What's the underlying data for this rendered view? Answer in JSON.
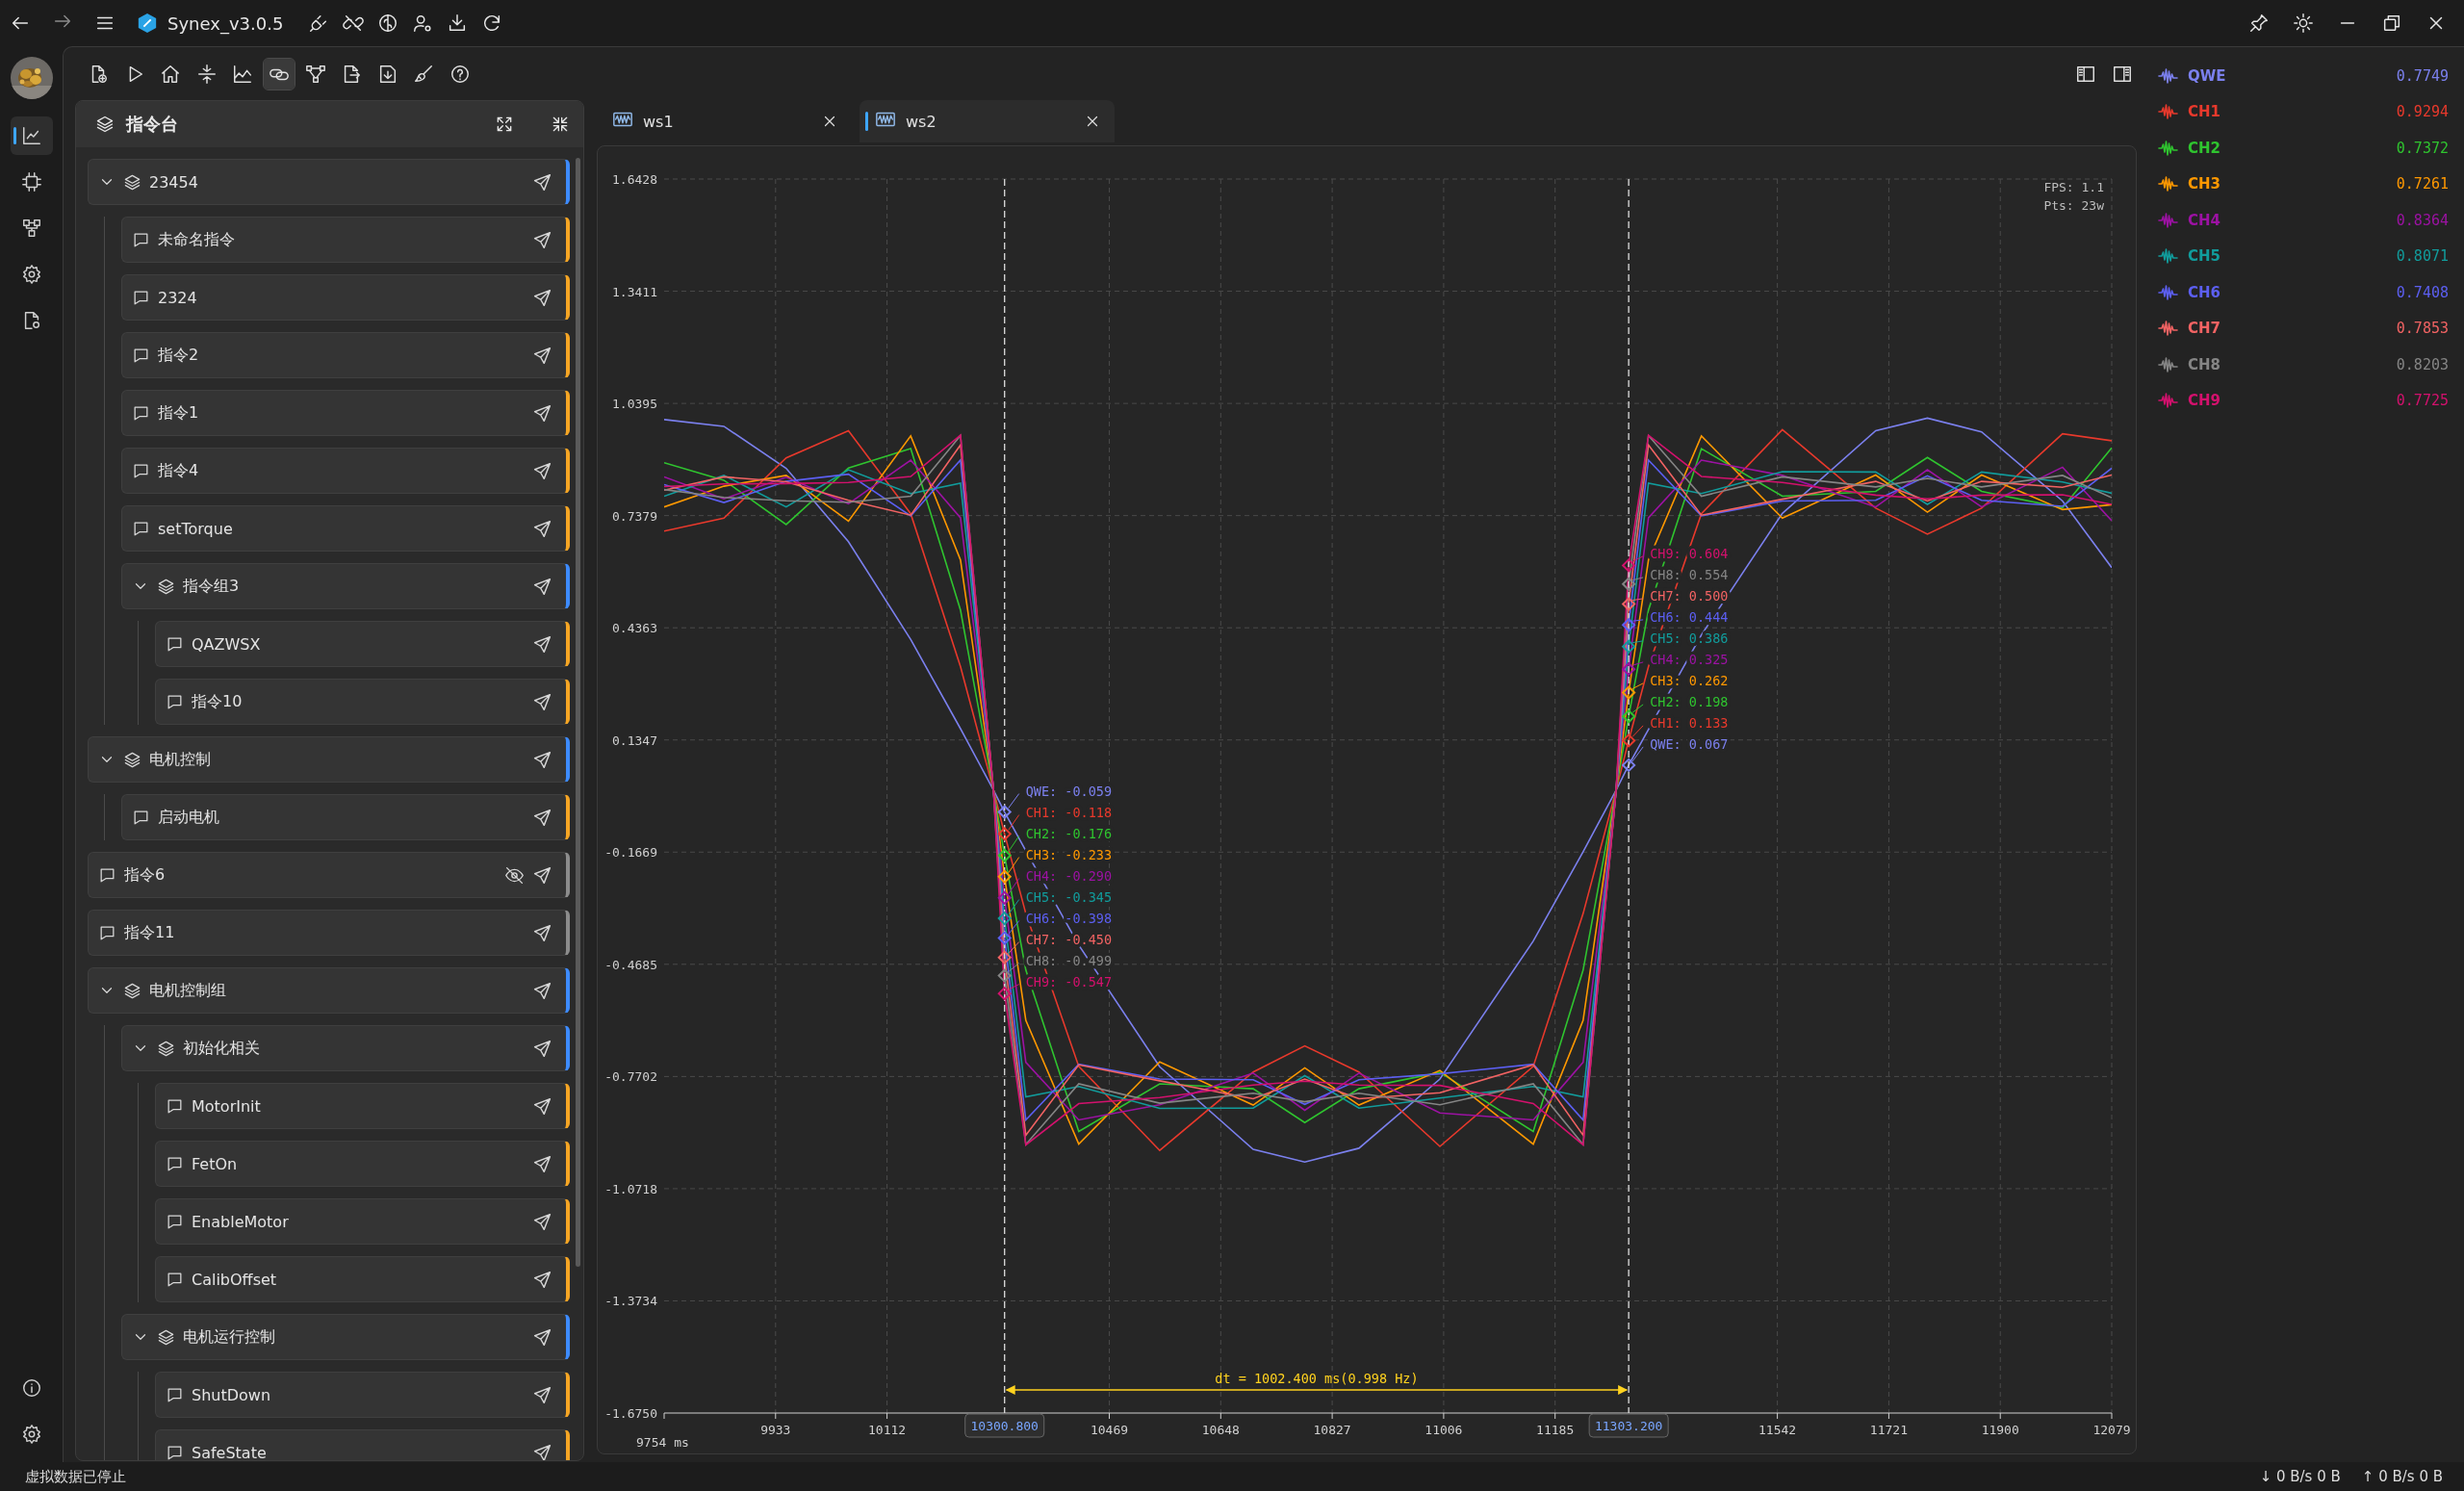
{
  "titlebar": {
    "title": "Synex_v3.0.5"
  },
  "sidebar": {
    "items": [
      {
        "kind": "chart",
        "selected": true
      },
      {
        "kind": "chip",
        "selected": false
      },
      {
        "kind": "network",
        "selected": false
      },
      {
        "kind": "gear",
        "selected": false
      },
      {
        "kind": "document",
        "selected": false
      }
    ]
  },
  "toolbar": [
    {
      "kind": "file-add",
      "selected": false
    },
    {
      "kind": "play",
      "selected": false
    },
    {
      "kind": "home",
      "selected": false
    },
    {
      "kind": "collapse",
      "selected": false
    },
    {
      "kind": "area-chart",
      "selected": false
    },
    {
      "kind": "link",
      "selected": true
    },
    {
      "kind": "nodes",
      "selected": false
    },
    {
      "kind": "export",
      "selected": false
    },
    {
      "kind": "import",
      "selected": false
    },
    {
      "kind": "brush",
      "selected": false
    },
    {
      "kind": "help",
      "selected": false
    }
  ],
  "command_panel": {
    "title": "指令台",
    "items": [
      {
        "kind": "group",
        "label": "23454",
        "expanded": true,
        "hidden": false,
        "children": [
          {
            "kind": "command",
            "label": "未命名指令",
            "hidden": false
          },
          {
            "kind": "command",
            "label": "2324",
            "hidden": false
          },
          {
            "kind": "command",
            "label": "指令2",
            "hidden": false
          },
          {
            "kind": "command",
            "label": "指令1",
            "hidden": false
          },
          {
            "kind": "command",
            "label": "指令4",
            "hidden": false
          },
          {
            "kind": "command",
            "label": "setTorque",
            "hidden": false
          },
          {
            "kind": "group",
            "label": "指令组3",
            "expanded": true,
            "hidden": false,
            "children": [
              {
                "kind": "command",
                "label": "QAZWSX",
                "hidden": false
              },
              {
                "kind": "command",
                "label": "指令10",
                "hidden": false
              }
            ]
          }
        ]
      },
      {
        "kind": "group",
        "label": "电机控制",
        "expanded": true,
        "hidden": false,
        "children": [
          {
            "kind": "command",
            "label": "启动电机",
            "hidden": false
          }
        ]
      },
      {
        "kind": "command",
        "label": "指令6",
        "hidden": true
      },
      {
        "kind": "command",
        "label": "指令11",
        "hidden": false
      },
      {
        "kind": "group",
        "label": "电机控制组",
        "expanded": true,
        "hidden": false,
        "children": [
          {
            "kind": "group",
            "label": "初始化相关",
            "expanded": true,
            "hidden": false,
            "children": [
              {
                "kind": "command",
                "label": "MotorInit",
                "hidden": false
              },
              {
                "kind": "command",
                "label": "FetOn",
                "hidden": false
              },
              {
                "kind": "command",
                "label": "EnableMotor",
                "hidden": false
              },
              {
                "kind": "command",
                "label": "CalibOffset",
                "hidden": false
              }
            ]
          },
          {
            "kind": "group",
            "label": "电机运行控制",
            "expanded": true,
            "hidden": false,
            "children": [
              {
                "kind": "command",
                "label": "ShutDown",
                "hidden": false
              },
              {
                "kind": "command",
                "label": "SafeState",
                "hidden": false
              }
            ]
          }
        ]
      }
    ]
  },
  "tabs": [
    {
      "label": "ws1",
      "selected": false
    },
    {
      "label": "ws2",
      "selected": true
    }
  ],
  "chart": {
    "stats": [
      "FPS: 1.1",
      "Pts: 23w"
    ],
    "cursor_readouts": [
      [
        {
          "text": "QWE: -0.059",
          "color": "#7b80ee"
        },
        {
          "text": "CH1: -0.118",
          "color": "#e8392c"
        },
        {
          "text": "CH2: -0.176",
          "color": "#2fc42f"
        },
        {
          "text": "CH3: -0.233",
          "color": "#ff9800"
        },
        {
          "text": "CH4: -0.290",
          "color": "#9c12a3"
        },
        {
          "text": "CH5: -0.345",
          "color": "#119c9c"
        },
        {
          "text": "CH6: -0.398",
          "color": "#5c5ff2"
        },
        {
          "text": "CH7: -0.450",
          "color": "#f26363"
        },
        {
          "text": "CH8: -0.499",
          "color": "#858585"
        },
        {
          "text": "CH9: -0.547",
          "color": "#d3116d"
        }
      ],
      [
        {
          "text": "CH9: 0.604",
          "color": "#d3116d"
        },
        {
          "text": "CH8: 0.554",
          "color": "#858585"
        },
        {
          "text": "CH7: 0.500",
          "color": "#f26363"
        },
        {
          "text": "CH6: 0.444",
          "color": "#5c5ff2"
        },
        {
          "text": "CH5: 0.386",
          "color": "#119c9c"
        },
        {
          "text": "CH4: 0.325",
          "color": "#9c12a3"
        },
        {
          "text": "CH3: 0.262",
          "color": "#ff9800"
        },
        {
          "text": "CH2: 0.198",
          "color": "#2fc42f"
        },
        {
          "text": "CH1: 0.133",
          "color": "#e8392c"
        },
        {
          "text": "QWE: 0.067",
          "color": "#7b80ee"
        }
      ]
    ],
    "chart_data": {
      "type": "line",
      "x": [
        9754,
        9850,
        9950,
        10050,
        10150,
        10230,
        10283,
        10300.8,
        10335,
        10420,
        10550,
        10700,
        10783,
        10870,
        11000,
        11150,
        11230,
        11283,
        11303.2,
        11335,
        11420,
        11550,
        11700,
        11783,
        11870,
        12000,
        12079
      ],
      "series": [
        {
          "name": "QWE",
          "color": "#7b80ee",
          "values": [
            0.996,
            0.978,
            0.865,
            0.668,
            0.405,
            0.165,
            0,
            -0.059,
            -0.163,
            -0.417,
            -0.744,
            -0.966,
            -1.0,
            -0.963,
            -0.777,
            -0.406,
            -0.166,
            0,
            0.067,
            0.163,
            0.417,
            0.744,
            0.966,
            1.0,
            0.963,
            0.777,
            0.598
          ]
        },
        {
          "name": "CH1",
          "color": "#e8392c",
          "values": [
            0.696,
            0.731,
            0.893,
            0.966,
            0.743,
            0.332,
            0,
            -0.118,
            -0.332,
            -0.743,
            -0.969,
            -0.758,
            -0.688,
            -0.758,
            -0.958,
            -0.743,
            -0.332,
            0,
            0.133,
            0.332,
            0.743,
            0.969,
            0.758,
            0.688,
            0.758,
            0.958,
            0.939
          ]
        },
        {
          "name": "CH2",
          "color": "#2fc42f",
          "values": [
            0.88,
            0.833,
            0.714,
            0.866,
            0.918,
            0.484,
            0,
            -0.176,
            -0.484,
            -0.918,
            -0.79,
            -0.803,
            -0.894,
            -0.803,
            -0.759,
            -0.918,
            -0.484,
            0,
            0.198,
            0.484,
            0.918,
            0.79,
            0.803,
            0.894,
            0.803,
            0.759,
            0.92
          ]
        },
        {
          "name": "CH3",
          "color": "#ff9800",
          "values": [
            0.761,
            0.817,
            0.846,
            0.723,
            0.952,
            0.619,
            0,
            -0.233,
            -0.619,
            -0.952,
            -0.731,
            -0.847,
            -0.747,
            -0.847,
            -0.754,
            -0.952,
            -0.619,
            0,
            0.262,
            0.619,
            0.952,
            0.731,
            0.847,
            0.747,
            0.847,
            0.754,
            0.767
          ]
        },
        {
          "name": "CH4",
          "color": "#9c12a3",
          "values": [
            0.842,
            0.783,
            0.841,
            0.77,
            0.887,
            0.732,
            0,
            -0.29,
            -0.732,
            -0.887,
            -0.846,
            -0.761,
            -0.861,
            -0.761,
            -0.868,
            -0.887,
            -0.732,
            0,
            0.325,
            0.732,
            0.887,
            0.846,
            0.761,
            0.861,
            0.761,
            0.868,
            0.724
          ]
        },
        {
          "name": "CH5",
          "color": "#119c9c",
          "values": [
            0.79,
            0.846,
            0.761,
            0.861,
            0.797,
            0.825,
            0,
            -0.345,
            -0.825,
            -0.797,
            -0.856,
            -0.855,
            -0.768,
            -0.855,
            -0.828,
            -0.797,
            -0.825,
            0,
            0.386,
            0.825,
            0.797,
            0.856,
            0.855,
            0.768,
            0.855,
            0.828,
            0.798
          ]
        },
        {
          "name": "CH6",
          "color": "#5c5ff2",
          "values": [
            0.821,
            0.773,
            0.83,
            0.849,
            0.737,
            0.887,
            0,
            -0.398,
            -0.887,
            -0.737,
            -0.777,
            -0.779,
            -0.845,
            -0.779,
            -0.763,
            -0.737,
            -0.887,
            0,
            0.444,
            0.887,
            0.737,
            0.777,
            0.779,
            0.845,
            0.779,
            0.763,
            0.865
          ]
        },
        {
          "name": "CH7",
          "color": "#f26363",
          "values": [
            0.806,
            0.842,
            0.829,
            0.779,
            0.739,
            0.928,
            0,
            -0.45,
            -0.928,
            -0.739,
            -0.782,
            -0.83,
            -0.777,
            -0.83,
            -0.814,
            -0.739,
            -0.928,
            0,
            0.5,
            0.928,
            0.739,
            0.782,
            0.83,
            0.777,
            0.83,
            0.814,
            0.847
          ]
        },
        {
          "name": "CH8",
          "color": "#858585",
          "values": [
            0.808,
            0.787,
            0.778,
            0.774,
            0.79,
            0.953,
            0,
            -0.499,
            -0.953,
            -0.79,
            -0.842,
            -0.815,
            -0.838,
            -0.815,
            -0.846,
            -0.79,
            -0.953,
            0,
            0.554,
            0.953,
            0.79,
            0.842,
            0.815,
            0.838,
            0.815,
            0.846,
            0.786
          ]
        },
        {
          "name": "CH9",
          "color": "#d3116d",
          "values": [
            0.816,
            0.823,
            0.824,
            0.827,
            0.843,
            0.954,
            0,
            -0.547,
            -0.954,
            -0.843,
            -0.827,
            -0.793,
            -0.783,
            -0.793,
            -0.794,
            -0.843,
            -0.954,
            0,
            0.604,
            0.954,
            0.843,
            0.827,
            0.793,
            0.783,
            0.793,
            0.794,
            0.768
          ]
        }
      ],
      "xlim": [
        9754,
        12079
      ],
      "ylim": [
        -1.675,
        1.6428
      ],
      "xlabel": "9754 ms",
      "grid": true,
      "xticks": [
        9933,
        10112,
        10469,
        10648,
        10827,
        11006,
        11185,
        11542,
        11721,
        11900,
        12079
      ],
      "yticks": [
        1.6428,
        1.3411,
        1.0395,
        0.7379,
        0.4363,
        0.1347,
        -0.1669,
        -0.4685,
        -0.7702,
        -1.0718,
        -1.3734,
        {
          "value": -1.675,
          "label": "-1.6750"
        }
      ],
      "ref_lines": [
        {
          "axis": "x",
          "value": 10300.8,
          "label": "10300.800"
        },
        {
          "axis": "x",
          "value": 11303.2,
          "label": "11303.200"
        }
      ],
      "annotations": [
        "dt = 1002.400 ms(0.998 Hz)"
      ]
    }
  },
  "legend": [
    {
      "value": "0.7749"
    },
    {
      "value": "0.9294"
    },
    {
      "value": "0.7372"
    },
    {
      "value": "0.7261"
    },
    {
      "value": "0.8364"
    },
    {
      "value": "0.8071"
    },
    {
      "value": "0.7408"
    },
    {
      "value": "0.7853"
    },
    {
      "value": "0.8203"
    },
    {
      "value": "0.7725"
    }
  ],
  "status_bar": {
    "message": "虚拟数据已停止",
    "download": "↓ 0 B/s 0 B",
    "upload": "↑ 0 B/s 0 B"
  }
}
